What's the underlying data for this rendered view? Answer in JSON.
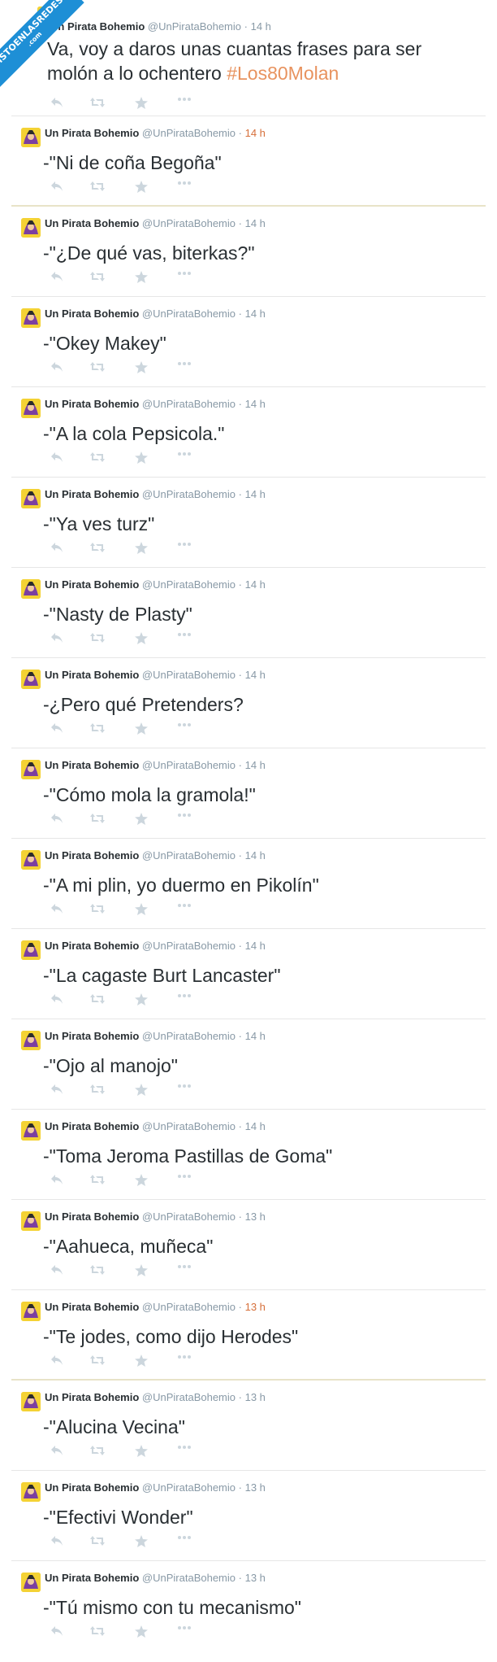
{
  "watermark": {
    "line1": "VISTOENLASREDES",
    "line2": ".com"
  },
  "hashtag_color": "#e8935f",
  "avatar_colors": {
    "main": "#f4d234",
    "accent": "#7b3fa0"
  },
  "action_icons": [
    "reply-icon",
    "retweet-icon",
    "favorite-icon",
    "more-icon"
  ],
  "tweets": [
    {
      "name": "Un Pirata Bohemio",
      "handle": "@UnPirataBohemio",
      "sep": "·",
      "time": "14 h",
      "text": "Va, voy a daros unas cuantas frases para ser molón a lo ochentero ",
      "hashtag": "#Los80Molan"
    },
    {
      "name": "Un Pirata Bohemio",
      "handle": "@UnPirataBohemio",
      "sep": "·",
      "time": "14 h",
      "text": "-\"Ni de coña Begoña\""
    },
    {
      "name": "Un Pirata Bohemio",
      "handle": "@UnPirataBohemio",
      "sep": "·",
      "time": "14 h",
      "text": "-\"¿De qué vas, biterkas?\""
    },
    {
      "name": "Un Pirata Bohemio",
      "handle": "@UnPirataBohemio",
      "sep": "·",
      "time": "14 h",
      "text": "-\"Okey Makey\""
    },
    {
      "name": "Un Pirata Bohemio",
      "handle": "@UnPirataBohemio",
      "sep": "·",
      "time": "14 h",
      "text": "-\"A la cola Pepsicola.\""
    },
    {
      "name": "Un Pirata Bohemio",
      "handle": "@UnPirataBohemio",
      "sep": "·",
      "time": "14 h",
      "text": "-\"Ya ves turz\""
    },
    {
      "name": "Un Pirata Bohemio",
      "handle": "@UnPirataBohemio",
      "sep": "·",
      "time": "14 h",
      "text": "-\"Nasty de Plasty\""
    },
    {
      "name": "Un Pirata Bohemio",
      "handle": "@UnPirataBohemio",
      "sep": "·",
      "time": "14 h",
      "text": "-¿Pero qué Pretenders?"
    },
    {
      "name": "Un Pirata Bohemio",
      "handle": "@UnPirataBohemio",
      "sep": "·",
      "time": "14 h",
      "text": "-\"Cómo mola la gramola!\""
    },
    {
      "name": "Un Pirata Bohemio",
      "handle": "@UnPirataBohemio",
      "sep": "·",
      "time": "14 h",
      "text": "-\"A mi plin, yo duermo en Pikolín\""
    },
    {
      "name": "Un Pirata Bohemio",
      "handle": "@UnPirataBohemio",
      "sep": "·",
      "time": "14 h",
      "text": "-\"La cagaste Burt Lancaster\""
    },
    {
      "name": "Un Pirata Bohemio",
      "handle": "@UnPirataBohemio",
      "sep": "·",
      "time": "14 h",
      "text": "-\"Ojo al manojo\""
    },
    {
      "name": "Un Pirata Bohemio",
      "handle": "@UnPirataBohemio",
      "sep": "·",
      "time": "14 h",
      "text": "-\"Toma Jeroma Pastillas de Goma\""
    },
    {
      "name": "Un Pirata Bohemio",
      "handle": "@UnPirataBohemio",
      "sep": "·",
      "time": "13 h",
      "text": "-\"Aahueca, muñeca\""
    },
    {
      "name": "Un Pirata Bohemio",
      "handle": "@UnPirataBohemio",
      "sep": "·",
      "time": "13 h",
      "text": "-\"Te jodes, como dijo Herodes\""
    },
    {
      "name": "Un Pirata Bohemio",
      "handle": "@UnPirataBohemio",
      "sep": "·",
      "time": "13 h",
      "text": "-\"Alucina Vecina\""
    },
    {
      "name": "Un Pirata Bohemio",
      "handle": "@UnPirataBohemio",
      "sep": "·",
      "time": "13 h",
      "text": "-\"Efectivi Wonder\""
    },
    {
      "name": "Un Pirata Bohemio",
      "handle": "@UnPirataBohemio",
      "sep": "·",
      "time": "13 h",
      "text": "-\"Tú mismo con tu mecanismo\""
    }
  ]
}
